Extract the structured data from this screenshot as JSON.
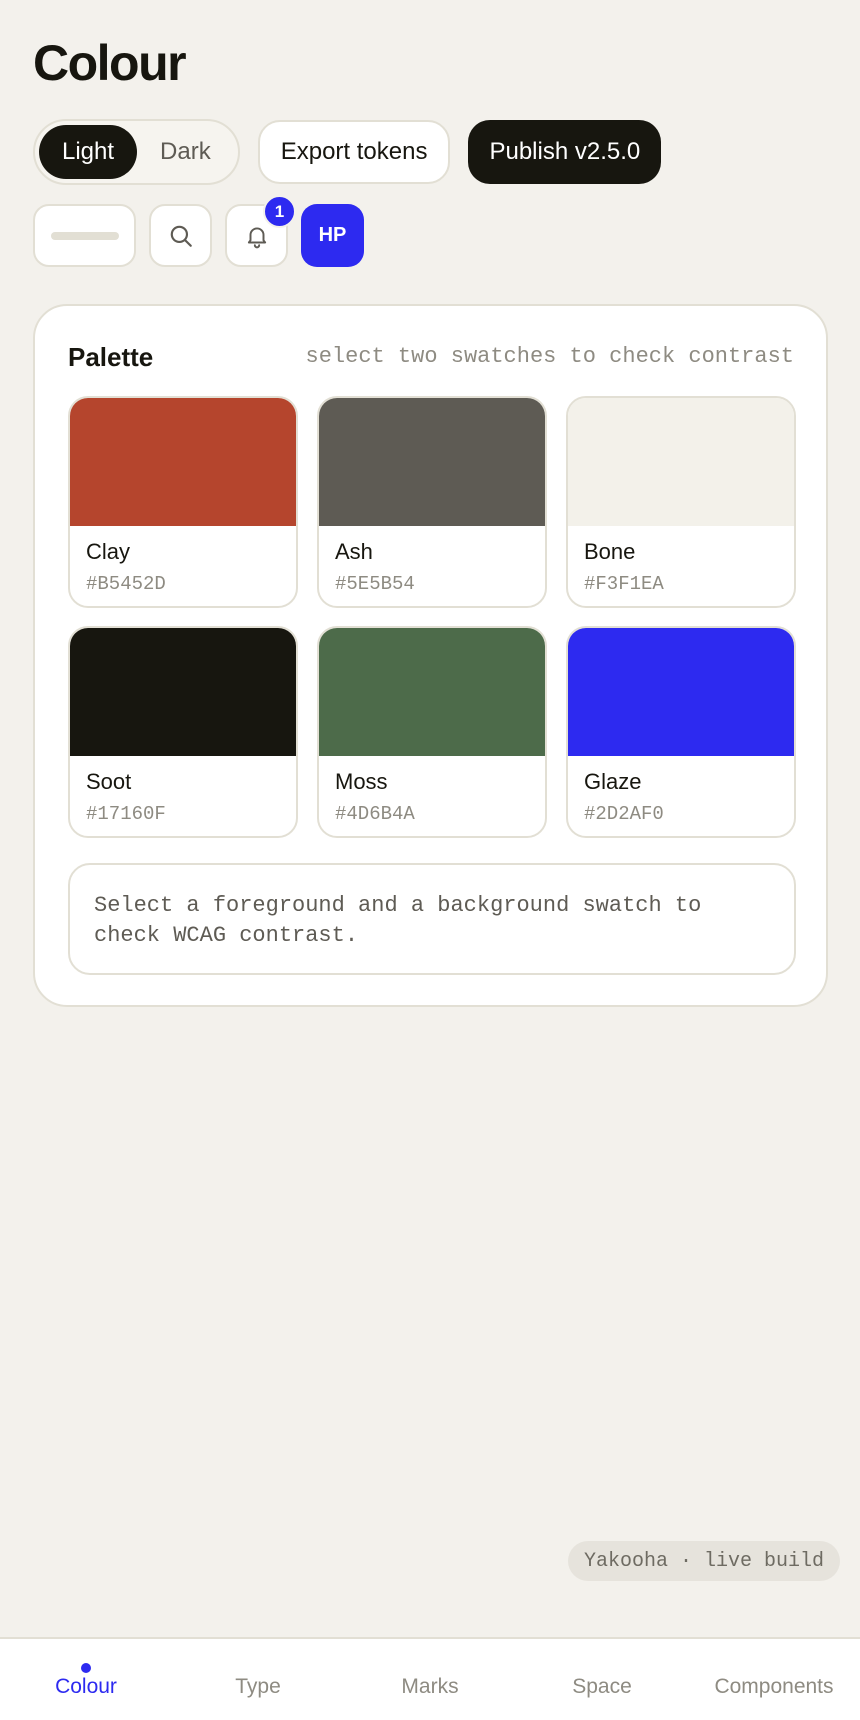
{
  "header": {
    "title": "Colour"
  },
  "theme_toggle": {
    "light_label": "Light",
    "dark_label": "Dark",
    "selected": "Light"
  },
  "actions": {
    "export_label": "Export tokens",
    "publish_label": "Publish v2.5.0"
  },
  "toolbar": {
    "search_icon": "search-icon",
    "bell_icon": "bell-icon",
    "notification_count": "1",
    "avatar_initials": "HP"
  },
  "palette": {
    "title": "Palette",
    "hint": "select two swatches to check contrast",
    "swatches": [
      {
        "name": "Clay",
        "hex": "#B5452D",
        "color": "#B5452D"
      },
      {
        "name": "Ash",
        "hex": "#5E5B54",
        "color": "#5E5B54"
      },
      {
        "name": "Bone",
        "hex": "#F3F1EA",
        "color": "#F3F1EA"
      },
      {
        "name": "Soot",
        "hex": "#17160F",
        "color": "#17160F"
      },
      {
        "name": "Moss",
        "hex": "#4D6B4A",
        "color": "#4D6B4A"
      },
      {
        "name": "Glaze",
        "hex": "#2D2AF0",
        "color": "#2D2AF0"
      }
    ],
    "contrast_message": "Select a foreground and a background swatch to check WCAG contrast."
  },
  "build_tag": "Yakooha · live build",
  "nav": {
    "items": [
      {
        "label": "Colour",
        "active": true
      },
      {
        "label": "Type",
        "active": false
      },
      {
        "label": "Marks",
        "active": false
      },
      {
        "label": "Space",
        "active": false
      },
      {
        "label": "Components",
        "active": false
      }
    ]
  },
  "colors": {
    "accent": "#2D2AF0",
    "ink": "#17160F",
    "background": "#F3F1EC",
    "border": "#E2DFD4"
  }
}
